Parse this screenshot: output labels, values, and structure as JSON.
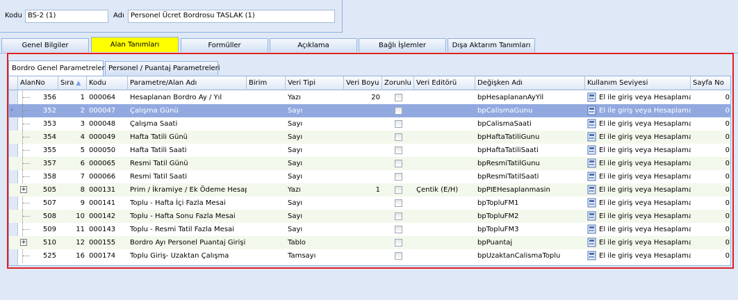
{
  "header": {
    "kodu_label": "Kodu",
    "kodu_value": "BS-2 (1)",
    "adi_label": "Adı",
    "adi_value": "Personel  Ücret Bordrosu TASLAK (1)"
  },
  "tabs": [
    {
      "label": "Genel Bilgiler"
    },
    {
      "label": "Alan Tanımları"
    },
    {
      "label": "Formüller"
    },
    {
      "label": "Açıklama"
    },
    {
      "label": "Bağlı İşlemler"
    },
    {
      "label": "Dışa Aktarım Tanımları"
    }
  ],
  "subtabs": [
    {
      "label": "Bordro Genel Parametreleri"
    },
    {
      "label": "Personel / Puantaj Parametreleri"
    }
  ],
  "columns": [
    {
      "label": "AlanNo"
    },
    {
      "label": "Sıra"
    },
    {
      "label": "Kodu"
    },
    {
      "label": "Parametre/Alan Adı"
    },
    {
      "label": "Birim"
    },
    {
      "label": "Veri Tipi"
    },
    {
      "label": "Veri Boyu"
    },
    {
      "label": "Zorunlu"
    },
    {
      "label": "Veri Editörü"
    },
    {
      "label": "Değişken Adı"
    },
    {
      "label": "Kullanım Seviyesi"
    },
    {
      "label": "Sayfa No"
    }
  ],
  "rows": [
    {
      "alanno": "356",
      "sira": "1",
      "kodu": "000064",
      "ad": "Hesaplanan Bordro Ay / Yıl",
      "birim": "",
      "tip": "Yazı",
      "boy": "20",
      "editor": "",
      "degisken": "bpHesaplananAyYil",
      "seviye": "El ile giriş veya Hesaplama",
      "sayfa": "0"
    },
    {
      "alanno": "352",
      "sira": "2",
      "kodu": "000047",
      "ad": "Çalışma Günü",
      "birim": "",
      "tip": "Sayı",
      "boy": "",
      "editor": "",
      "degisken": "bpCalismaGunu",
      "seviye": "El ile giriş veya Hesaplama",
      "sayfa": "0"
    },
    {
      "alanno": "353",
      "sira": "3",
      "kodu": "000048",
      "ad": "Çalışma Saati",
      "birim": "",
      "tip": "Sayı",
      "boy": "",
      "editor": "",
      "degisken": "bpCalismaSaati",
      "seviye": "El ile giriş veya Hesaplama",
      "sayfa": "0"
    },
    {
      "alanno": "354",
      "sira": "4",
      "kodu": "000049",
      "ad": "Hafta Tatili Günü",
      "birim": "",
      "tip": "Sayı",
      "boy": "",
      "editor": "",
      "degisken": "bpHaftaTatiliGunu",
      "seviye": "El ile giriş veya Hesaplama",
      "sayfa": "0"
    },
    {
      "alanno": "355",
      "sira": "5",
      "kodu": "000050",
      "ad": "Hafta Tatili Saati",
      "birim": "",
      "tip": "Sayı",
      "boy": "",
      "editor": "",
      "degisken": "bpHaftaTatiliSaati",
      "seviye": "El ile giriş veya Hesaplama",
      "sayfa": "0"
    },
    {
      "alanno": "357",
      "sira": "6",
      "kodu": "000065",
      "ad": "Resmi Tatil Günü",
      "birim": "",
      "tip": "Sayı",
      "boy": "",
      "editor": "",
      "degisken": "bpResmiTatilGunu",
      "seviye": "El ile giriş veya Hesaplama",
      "sayfa": "0"
    },
    {
      "alanno": "358",
      "sira": "7",
      "kodu": "000066",
      "ad": "Resmi Tatil Saati",
      "birim": "",
      "tip": "Sayı",
      "boy": "",
      "editor": "",
      "degisken": "bpResmiTatilSaati",
      "seviye": "El ile giriş veya Hesaplama",
      "sayfa": "0"
    },
    {
      "alanno": "505",
      "sira": "8",
      "kodu": "000131",
      "ad": "Prim / İkramiye / Ek Ödeme Hesapla",
      "birim": "",
      "tip": "Yazı",
      "boy": "1",
      "editor": "Çentik (E/H)",
      "degisken": "bpPIEHesaplanmasin",
      "seviye": "El ile giriş veya Hesaplama",
      "sayfa": "0"
    },
    {
      "alanno": "507",
      "sira": "9",
      "kodu": "000141",
      "ad": "Toplu - Hafta İçi Fazla Mesai",
      "birim": "",
      "tip": "Sayı",
      "boy": "",
      "editor": "",
      "degisken": "bpTopluFM1",
      "seviye": "El ile giriş veya Hesaplama",
      "sayfa": "0"
    },
    {
      "alanno": "508",
      "sira": "10",
      "kodu": "000142",
      "ad": "Toplu - Hafta Sonu Fazla Mesai",
      "birim": "",
      "tip": "Sayı",
      "boy": "",
      "editor": "",
      "degisken": "bpTopluFM2",
      "seviye": "El ile giriş veya Hesaplama",
      "sayfa": "0"
    },
    {
      "alanno": "509",
      "sira": "11",
      "kodu": "000143",
      "ad": "Toplu - Resmi Tatil Fazla Mesai",
      "birim": "",
      "tip": "Sayı",
      "boy": "",
      "editor": "",
      "degisken": "bpTopluFM3",
      "seviye": "El ile giriş veya Hesaplama",
      "sayfa": "0"
    },
    {
      "alanno": "510",
      "sira": "12",
      "kodu": "000155",
      "ad": "Bordro Ayı Personel Puantaj Girişi",
      "birim": "",
      "tip": "Tablo",
      "boy": "",
      "editor": "",
      "degisken": "bpPuantaj",
      "seviye": "El ile giriş veya Hesaplama",
      "sayfa": "0"
    },
    {
      "alanno": "525",
      "sira": "16",
      "kodu": "000174",
      "ad": "Toplu Giriş- Uzaktan Çalışma",
      "birim": "",
      "tip": "Tamsayı",
      "boy": "",
      "editor": "",
      "degisken": "bpUzaktanCalismaToplu",
      "seviye": "El ile giriş veya Hesaplama",
      "sayfa": "0"
    }
  ],
  "colors": {
    "active_tab": "#ffff00",
    "selection": "#92a9e0",
    "frame": "#e02020"
  }
}
